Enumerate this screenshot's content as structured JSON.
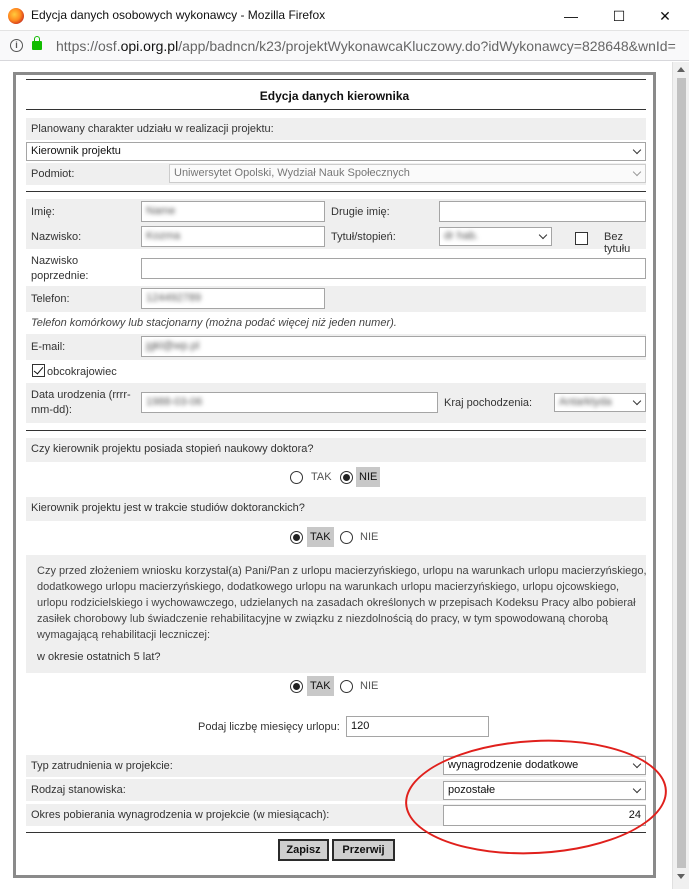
{
  "window": {
    "title": "Edycja danych osobowych wykonawcy - Mozilla Firefox",
    "url_prefix": "https://osf.",
    "url_domain": "opi.org.pl",
    "url_rest": "/app/badncn/k23/projektWykonawcaKluczowy.do?idWykonawcy=828648&wnId=",
    "minimize": "—",
    "maximize": "☐",
    "close": "✕"
  },
  "dialog": {
    "title": "Edycja danych kierownika",
    "role_label": "Planowany charakter udziału w realizacji projektu:",
    "role_value": "Kierownik projektu",
    "entity_label": "Podmiot:",
    "entity_value": "Uniwersytet Opolski, Wydział Nauk Społecznych",
    "first_name_label": "Imię:",
    "first_name_value": "Name",
    "second_name_label": "Drugie imię:",
    "second_name_value": "",
    "surname_label": "Nazwisko:",
    "surname_value": "Kozma",
    "title_label": "Tytuł/stopień:",
    "title_value": "dr hab.",
    "no_title_label": "Bez tytułu",
    "prev_surname_label_1": "Nazwisko",
    "prev_surname_label_2": "poprzednie:",
    "prev_surname_value": "",
    "phone_label": "Telefon:",
    "phone_value": "124492789",
    "phone_hint": "Telefon komórkowy lub stacjonarny (można podać więcej niż jeden numer).",
    "email_label": "E-mail:",
    "email_value": "jgkl@wp.pl",
    "foreigner_label": "obcokrajowiec",
    "birth_label_1": "Data urodzenia (rrrr-",
    "birth_label_2": "mm-dd):",
    "birth_value": "1988-03-06",
    "country_label": "Kraj pochodzenia:",
    "country_value": "Antarktyda",
    "q_doctor": "Czy kierownik projektu posiada stopień naukowy doktora?",
    "q_phd": "Kierownik projektu jest w trakcie studiów doktoranckich?",
    "yes": "TAK",
    "no": "NIE",
    "q_leave_lines": [
      "Czy przed złożeniem wniosku korzystał(a) Pani/Pan z urlopu macierzyńskiego, urlopu na warunkach urlopu macierzyńskiego,",
      "dodatkowego urlopu macierzyńskiego, dodatkowego urlopu na warunkach urlopu macierzyńskiego, urlopu ojcowskiego,",
      "urlopu rodzicielskiego i wychowawczego, udzielanych na zasadach określonych w przepisach Kodeksu Pracy albo pobierał",
      "zasiłek chorobowy lub świadczenie rehabilitacyjne w związku z niezdolnością do pracy, w tym spowodowaną chorobą",
      "wymagającą rehabilitacji leczniczej:"
    ],
    "q_leave_period": "w okresie ostatnich 5 lat?",
    "months_label": "Podaj liczbę miesięcy urlopu:",
    "months_value": "120",
    "employment_label": "Typ zatrudnienia w projekcie:",
    "employment_value": "wynagrodzenie dodatkowe",
    "position_label": "Rodzaj stanowiska:",
    "position_value": "pozostałe",
    "salary_period_label": "Okres pobierania wynagrodzenia w projekcie (w miesiącach):",
    "salary_period_value": "24",
    "save": "Zapisz",
    "cancel": "Przerwij"
  },
  "state": {
    "doctor": "NIE",
    "phd_student": "TAK",
    "leave": "TAK",
    "foreigner": true,
    "no_title": false
  },
  "colors": {
    "annotation": "#e0201c",
    "selected_radio_bg": "#c8c8c8",
    "row_gray": "#efefef"
  }
}
